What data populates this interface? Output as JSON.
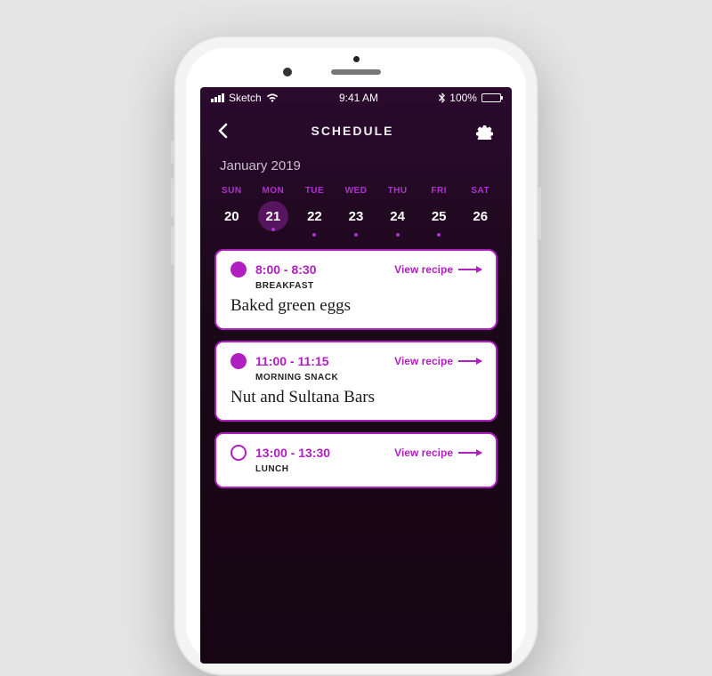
{
  "status": {
    "carrier": "Sketch",
    "time": "9:41 AM",
    "battery": "100%"
  },
  "nav": {
    "title": "SCHEDULE"
  },
  "month": "January 2019",
  "week": [
    {
      "name": "SUN",
      "num": "20",
      "dot": false,
      "selected": false
    },
    {
      "name": "MON",
      "num": "21",
      "dot": true,
      "selected": true
    },
    {
      "name": "TUE",
      "num": "22",
      "dot": true,
      "selected": false
    },
    {
      "name": "WED",
      "num": "23",
      "dot": true,
      "selected": false
    },
    {
      "name": "THU",
      "num": "24",
      "dot": true,
      "selected": false
    },
    {
      "name": "FRI",
      "num": "25",
      "dot": true,
      "selected": false
    },
    {
      "name": "SAT",
      "num": "26",
      "dot": false,
      "selected": false
    }
  ],
  "meals": [
    {
      "time": "8:00 - 8:30",
      "label": "BREAKFAST",
      "name": "Baked green eggs",
      "done": true,
      "link": "View recipe"
    },
    {
      "time": "11:00 - 11:15",
      "label": "MORNING SNACK",
      "name": "Nut and Sultana Bars",
      "done": true,
      "link": "View recipe"
    },
    {
      "time": "13:00 - 13:30",
      "label": "LUNCH",
      "name": "",
      "done": false,
      "link": "View recipe"
    }
  ]
}
